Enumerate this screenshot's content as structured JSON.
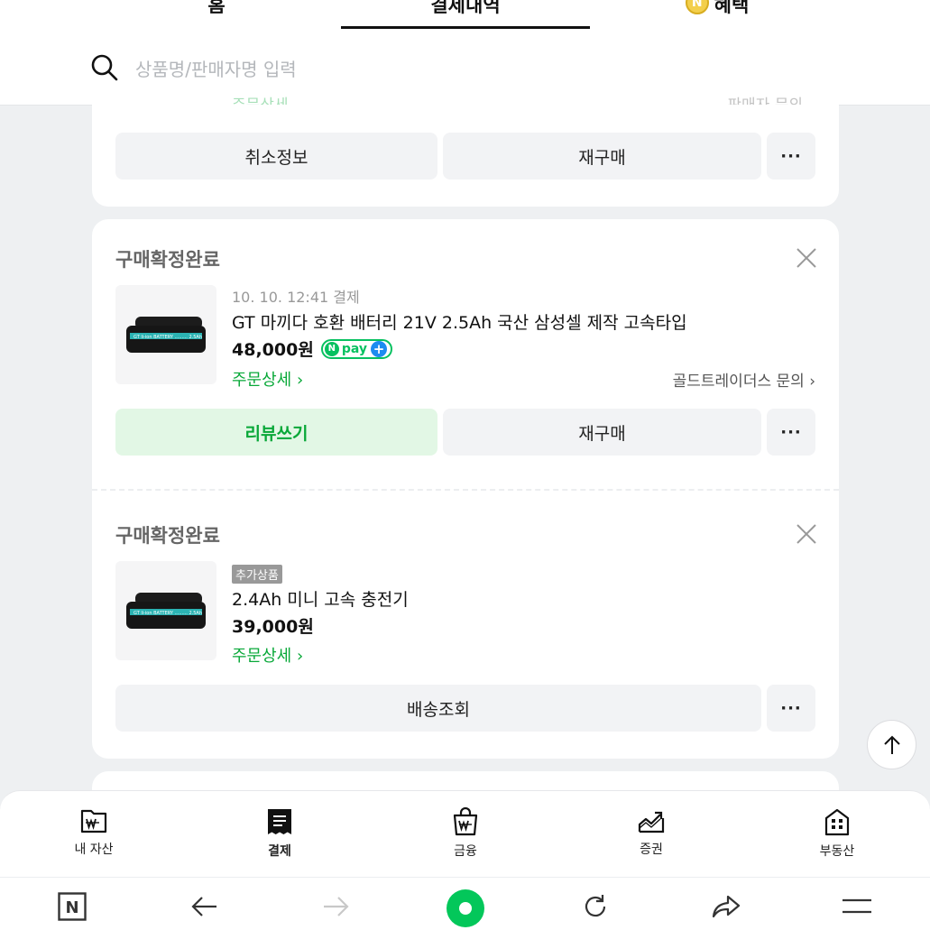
{
  "tabs": [
    {
      "label": "홈"
    },
    {
      "label": "결제내역"
    },
    {
      "label": "혜택",
      "coin": "N"
    }
  ],
  "search": {
    "placeholder": "상품명/판매자명 입력"
  },
  "card0": {
    "partial_left": "주문상세",
    "partial_right": "판매자 문의",
    "btn_cancel": "취소정보",
    "btn_rebuy": "재구매",
    "btn_more": "···"
  },
  "order1": {
    "status": "구매확정완료",
    "datetime": "10. 10. 12:41 결제",
    "product_name": "GT 마끼다 호환 배터리 21V 2.5Ah 국산 삼성셀 제작 고속타입",
    "price": "48,000원",
    "npay_label": "pay",
    "npay_n": "N",
    "npay_plus": "+",
    "order_detail": "주문상세 ›",
    "seller_inquiry": "골드트레이더스 문의 ›",
    "btn_review": "리뷰쓰기",
    "btn_rebuy": "재구매",
    "btn_more": "···"
  },
  "order2": {
    "status": "구매확정완료",
    "tag": "추가상품",
    "product_name": "2.4Ah 미니 고속 충전기",
    "price": "39,000원",
    "order_detail": "주문상세 ›",
    "btn_delivery": "배송조회",
    "btn_more": "···"
  },
  "bottom_nav": [
    {
      "label": "내 자산",
      "icon": "wallet-icon"
    },
    {
      "label": "결제",
      "icon": "receipt-icon",
      "active": true
    },
    {
      "label": "금융",
      "icon": "money-bag-icon"
    },
    {
      "label": "증권",
      "icon": "stock-chart-icon"
    },
    {
      "label": "부동산",
      "icon": "building-icon"
    }
  ],
  "browser_bar": {
    "home_letter": "N",
    "icons": [
      "naver-home-icon",
      "back-arrow-icon",
      "forward-arrow-icon",
      "green-dot-icon",
      "refresh-icon",
      "share-icon",
      "menu-icon"
    ]
  },
  "colors": {
    "green": "#08a838",
    "npay_green": "#07c160",
    "bg": "#eef0f2"
  }
}
